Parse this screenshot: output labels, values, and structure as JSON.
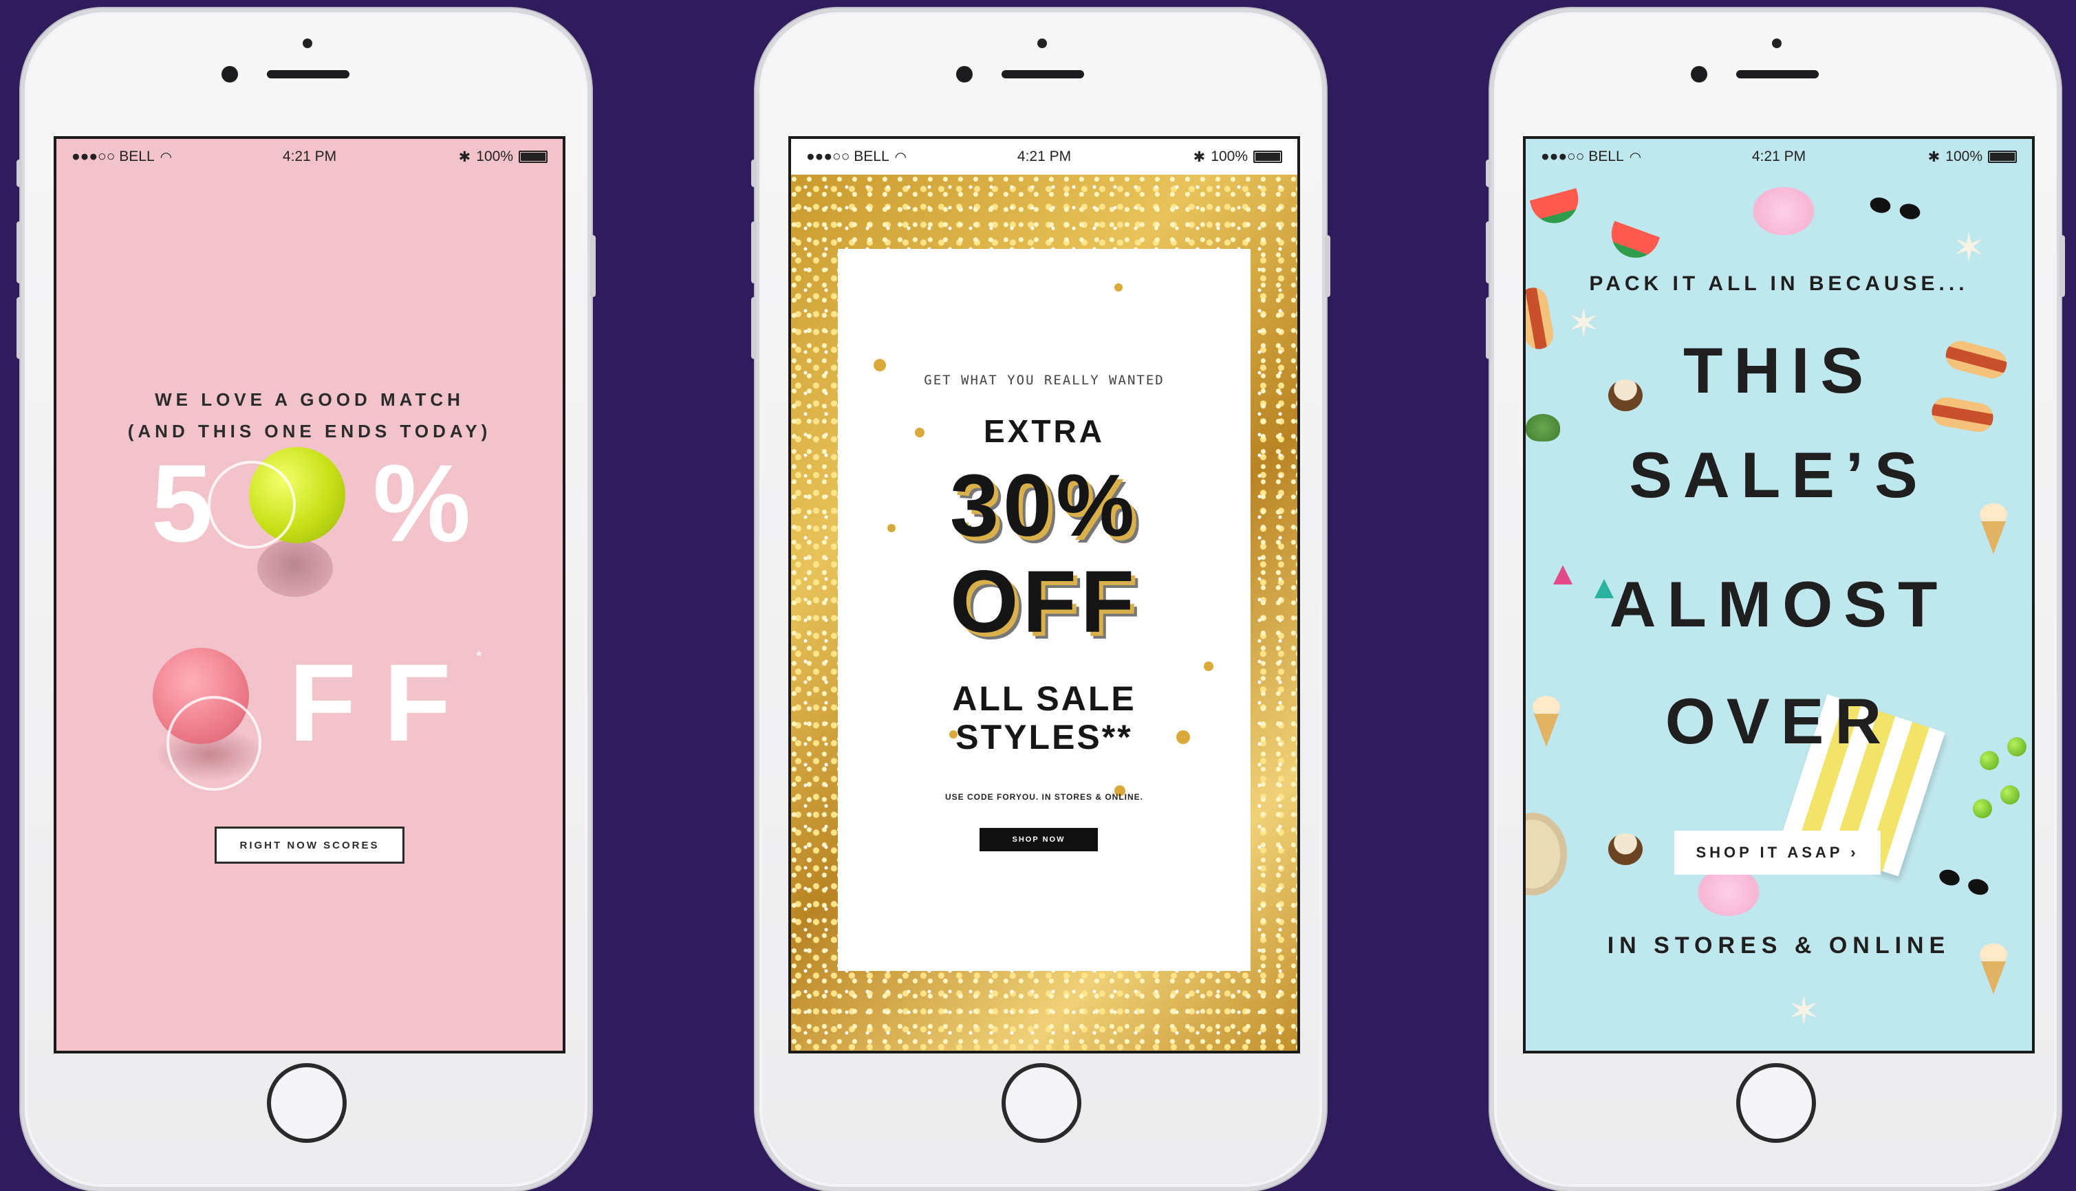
{
  "background_color": "#2e1c5c",
  "status_bar": {
    "carrier": "●●●○○ BELL",
    "wifi_icon": "wifi-icon",
    "time": "4:21 PM",
    "bluetooth_icon": "bluetooth-icon",
    "battery": "100%"
  },
  "phone1": {
    "line1": "WE LOVE A GOOD MATCH",
    "line2": "(AND THIS ONE ENDS TODAY)",
    "digit_five": "5",
    "percent": "%",
    "ff": "FF",
    "asterisk": "*",
    "button": "RIGHT NOW SCORES",
    "bg_color": "#f2c3cb"
  },
  "phone2": {
    "small_line": "GET WHAT YOU REALLY WANTED",
    "extra": "EXTRA",
    "percent": "30%",
    "off": "OFF",
    "all_sale": "ALL SALE",
    "styles": "STYLES**",
    "code_line": "USE CODE FORYOU. IN STORES & ONLINE.",
    "button": "SHOP NOW",
    "accent_color": "#d9b04a"
  },
  "phone3": {
    "pack_line": "PACK IT ALL IN BECAUSE...",
    "line1": "THIS",
    "line2": "SALE’S",
    "line3": "ALMOST",
    "line4": "OVER",
    "button": "SHOP IT ASAP ›",
    "footer": "IN STORES & ONLINE",
    "bg_color": "#bfe7ee"
  }
}
